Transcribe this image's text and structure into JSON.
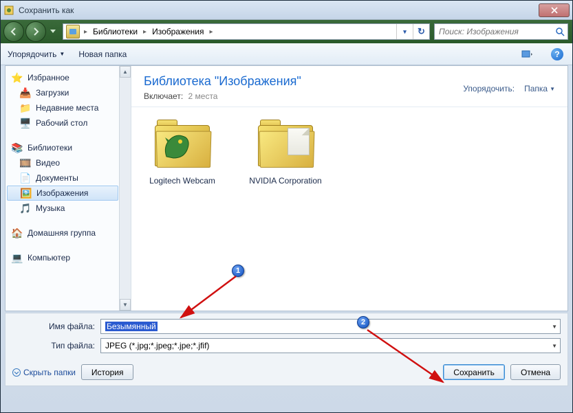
{
  "window": {
    "title": "Сохранить как"
  },
  "breadcrumbs": {
    "level1": "Библиотеки",
    "level2": "Изображения"
  },
  "search": {
    "placeholder": "Поиск: Изображения"
  },
  "toolbar": {
    "organize": "Упорядочить",
    "new_folder": "Новая папка"
  },
  "sidebar": {
    "favorites": "Избранное",
    "downloads": "Загрузки",
    "recent": "Недавние места",
    "desktop": "Рабочий стол",
    "libraries": "Библиотеки",
    "video": "Видео",
    "documents": "Документы",
    "images": "Изображения",
    "music": "Музыка",
    "homegroup": "Домашняя группа",
    "computer": "Компьютер"
  },
  "main": {
    "title": "Библиотека \"Изображения\"",
    "includes_label": "Включает:",
    "includes_value": "2 места",
    "arrange_label": "Упорядочить:",
    "arrange_value": "Папка"
  },
  "folders": {
    "f1": "Logitech Webcam",
    "f2": "NVIDIA Corporation"
  },
  "fields": {
    "filename_label": "Имя файла:",
    "filename_value": "Безымянный",
    "filetype_label": "Тип файла:",
    "filetype_value": "JPEG (*.jpg;*.jpeg;*.jpe;*.jfif)"
  },
  "buttons": {
    "hide_folders": "Скрыть папки",
    "history": "История",
    "save": "Сохранить",
    "cancel": "Отмена"
  },
  "annotations": {
    "n1": "1",
    "n2": "2"
  }
}
